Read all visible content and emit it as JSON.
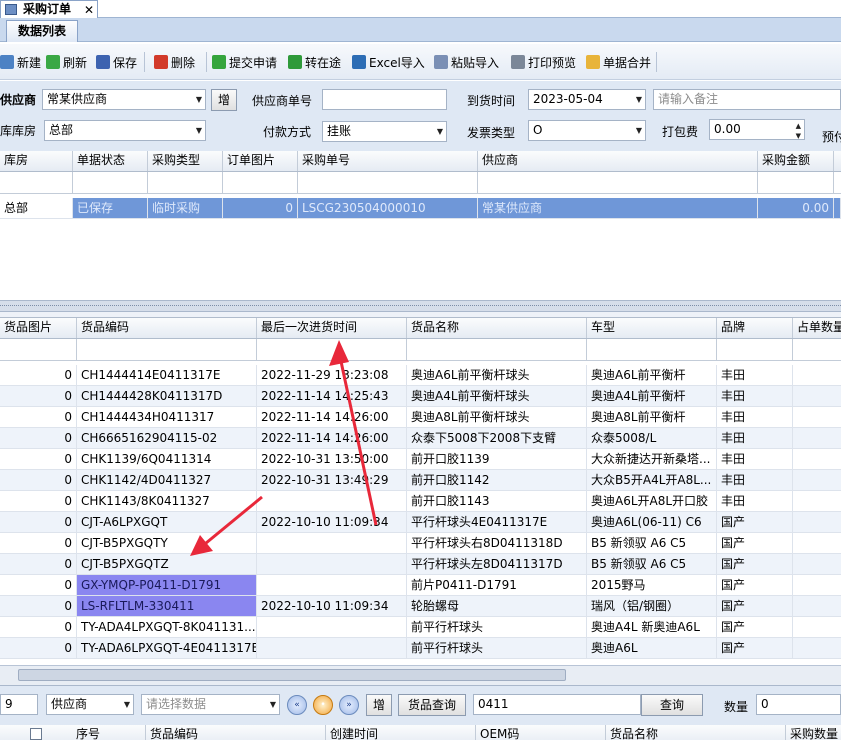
{
  "tabs": {
    "doc_tab": "采购订单",
    "close": "✕",
    "sub_tab": "数据列表"
  },
  "toolbar": [
    {
      "name": "new",
      "label": "新建",
      "icon": "new-doc-icon",
      "color": "#4d82c4"
    },
    {
      "name": "refresh",
      "label": "刷新",
      "icon": "refresh-icon",
      "color": "#3aa845"
    },
    {
      "name": "save",
      "label": "保存",
      "icon": "save-icon",
      "color": "#3d63b0"
    },
    {
      "name": "delete",
      "label": "删除",
      "icon": "delete-icon",
      "color": "#d23a2a"
    },
    {
      "name": "submit",
      "label": "提交申请",
      "icon": "submit-icon",
      "color": "#35a53d"
    },
    {
      "name": "transit",
      "label": "转在途",
      "icon": "arrow-right-icon",
      "color": "#2f9a3a"
    },
    {
      "name": "excel",
      "label": "Excel导入",
      "icon": "excel-icon",
      "color": "#2d6db5"
    },
    {
      "name": "paste",
      "label": "粘贴导入",
      "icon": "paste-icon",
      "color": "#7a8fb5"
    },
    {
      "name": "preview",
      "label": "打印预览",
      "icon": "print-icon",
      "color": "#7b8798"
    },
    {
      "name": "merge",
      "label": "单据合并",
      "icon": "merge-icon",
      "color": "#e8b43a"
    }
  ],
  "form": {
    "supplier_label": "供应商",
    "supplier_value": "常某供应商",
    "add_button": "增",
    "supplier_no_label": "供应商单号",
    "supplier_no_value": "",
    "arrival_label": "到货时间",
    "arrival_value": "2023-05-04",
    "remark_placeholder": "请输入备注",
    "warehouse_label": "库库房",
    "warehouse_value": "总部",
    "payment_label": "付款方式",
    "payment_value": "挂账",
    "invoice_label": "发票类型",
    "invoice_value": "O",
    "packing_label": "打包费",
    "packing_value": "0.00",
    "prepay_label": "预付"
  },
  "order_grid": {
    "headers": [
      "库房",
      "单据状态",
      "采购类型",
      "订单图片",
      "采购单号",
      "供应商",
      "采购金额"
    ],
    "rows": [
      [
        "总部",
        "已保存",
        "临时采购",
        "0",
        "LSCG230504000010",
        "常某供应商",
        "0.00"
      ]
    ]
  },
  "item_grid": {
    "headers": [
      "货品图片",
      "货品编码",
      "最后一次进货时间",
      "货品名称",
      "车型",
      "品牌",
      "占单数量"
    ],
    "rows": [
      [
        "0",
        "CH1444414E0411317E",
        "2022-11-29 13:23:08",
        "奥迪A6L前平衡杆球头",
        "奥迪A6L前平衡杆",
        "丰田"
      ],
      [
        "0",
        "CH1444428K0411317D",
        "2022-11-14 14:25:43",
        "奥迪A4L前平衡杆球头",
        "奥迪A4L前平衡杆",
        "丰田"
      ],
      [
        "0",
        "CH1444434H0411317",
        "2022-11-14 14:26:00",
        "奥迪A8L前平衡杆球头",
        "奥迪A8L前平衡杆",
        "丰田"
      ],
      [
        "0",
        "CH6665162904115-02",
        "2022-11-14 14:26:00",
        "众泰下5008下2008下支臂",
        "众泰5008/L",
        "丰田"
      ],
      [
        "0",
        "CHK1139/6Q0411314",
        "2022-10-31 13:50:00",
        "前开口胶1139",
        "大众新捷达开新桑塔...",
        "丰田"
      ],
      [
        "0",
        "CHK1142/4D0411327",
        "2022-10-31 13:49:29",
        "前开口胶1142",
        "大众B5开A4L开A8L...",
        "丰田"
      ],
      [
        "0",
        "CHK1143/8K0411327",
        "",
        "前开口胶1143",
        "奥迪A6L开A8L开口胶",
        "丰田"
      ],
      [
        "0",
        "CJT-A6LPXGQT",
        "2022-10-10 11:09:34",
        "平行杆球头4E0411317E",
        "奥迪A6L(06-11) C6",
        "国产"
      ],
      [
        "0",
        "CJT-B5PXGQTY",
        "",
        "平行杆球头右8D0411318D",
        "B5 新领驭 A6 C5",
        "国产"
      ],
      [
        "0",
        "CJT-B5PXGQTZ",
        "",
        "平行杆球头左8D0411317D",
        "B5 新领驭 A6 C5",
        "国产"
      ],
      [
        "0",
        "GX-YMQP-P0411-D1791",
        "",
        "前片P0411-D1791",
        "2015野马",
        "国产"
      ],
      [
        "0",
        "LS-RFLTLM-330411",
        "2022-10-10 11:09:34",
        "轮胎螺母",
        "瑞风（铝/钢圈）",
        "国产"
      ],
      [
        "0",
        "TY-ADA4LPXGQT-8K041131...",
        "",
        "前平行杆球头",
        "奥迪A4L 新奥迪A6L",
        "国产"
      ],
      [
        "0",
        "TY-ADA6LPXGQT-4E0411317E",
        "",
        "前平行杆球头",
        "奥迪A6L",
        "国产"
      ]
    ]
  },
  "bottom": {
    "page_fragment": "9",
    "filter_field": "供应商",
    "filter_placeholder": "请选择数据",
    "nav": [
      "«",
      "•",
      "»"
    ],
    "add_button": "增",
    "query_label": "货品查询",
    "query_value": "0411",
    "search_button": "查询",
    "qty_label": "数量",
    "qty_value": "0"
  },
  "lower_grid": {
    "headers": [
      "序号",
      "货品编码",
      "创建时间",
      "OEM码",
      "货品名称",
      "采购数量"
    ]
  },
  "colors": {
    "selection": "#6f97d8",
    "highlight": "#8a86f0",
    "annotation_arrow": "#e8283a"
  }
}
